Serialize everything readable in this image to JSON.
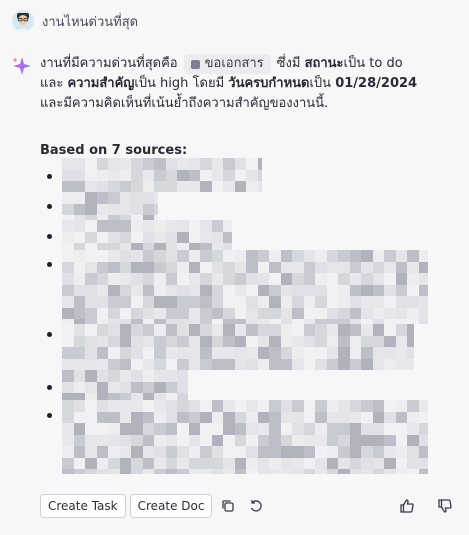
{
  "user_message": {
    "text": "งานไหนด่วนที่สุด",
    "avatar_icon": "user-avatar-icon"
  },
  "answer": {
    "intro": "งานที่มีความด่วนที่สุดคือ",
    "task_chip_label": "ขอเอกสาร",
    "status_prefix": "ซึ่งมี",
    "status_label": "สถานะ",
    "status_mid": "เป็น to do",
    "and": "และ",
    "priority_label": "ความสำคัญ",
    "priority_mid": "เป็น high โดยมี",
    "due_label": "วันครบกำหนด",
    "due_mid": "เป็น",
    "due_date": "01/28/2024",
    "closing": "และมีความคิดเห็นที่เน้นย้ำถึงความสำคัญของงานนี้."
  },
  "sources": {
    "title": "Based on 7 sources:",
    "count": 7
  },
  "toolbar": {
    "create_task_label": "Create Task",
    "create_doc_label": "Create Doc"
  },
  "colors": {
    "background": "#f7f7f8",
    "chip_bg": "#ececef",
    "text": "#2a2a35",
    "redacted_light": "#e3e3e8",
    "redacted_dark": "#a9a9b4"
  }
}
